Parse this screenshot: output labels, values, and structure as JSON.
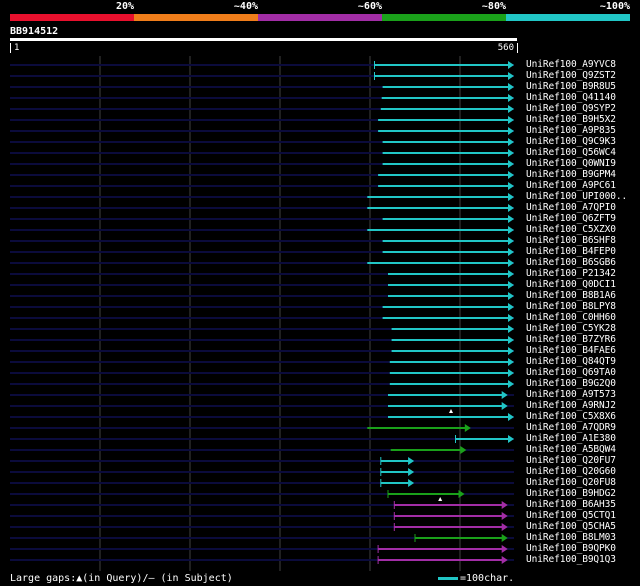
{
  "legend": {
    "labels": [
      "20%",
      "~40%",
      "~60%",
      "~80%",
      "~100%"
    ],
    "colors": [
      "#e8102d",
      "#ef7d1a",
      "#a22da6",
      "#1aa11a",
      "#21c6c6"
    ]
  },
  "query": {
    "id": "BB914512",
    "start": "1",
    "end": "560",
    "length": 560
  },
  "colors": {
    "line_color": "#0b0b3c",
    "grid_color": "#404040"
  },
  "hits": [
    {
      "label": "UniRef100_A9YVC8",
      "start": 405,
      "end": 560,
      "color": "cyan",
      "ticks": [
        405
      ]
    },
    {
      "label": "UniRef100_Q9ZST2",
      "start": 405,
      "end": 560,
      "color": "cyan",
      "ticks": [
        405
      ]
    },
    {
      "label": "UniRef100_B9R8U5",
      "start": 414,
      "end": 560,
      "color": "cyan",
      "ticks": []
    },
    {
      "label": "UniRef100_Q41140",
      "start": 413,
      "end": 560,
      "color": "cyan",
      "ticks": []
    },
    {
      "label": "UniRef100_Q9SYP2",
      "start": 412,
      "end": 560,
      "color": "cyan",
      "ticks": []
    },
    {
      "label": "UniRef100_B9H5X2",
      "start": 409,
      "end": 560,
      "color": "cyan",
      "ticks": []
    },
    {
      "label": "UniRef100_A9P835",
      "start": 409,
      "end": 560,
      "color": "cyan",
      "ticks": []
    },
    {
      "label": "UniRef100_Q9C9K3",
      "start": 414,
      "end": 560,
      "color": "cyan",
      "ticks": []
    },
    {
      "label": "UniRef100_Q56WC4",
      "start": 414,
      "end": 560,
      "color": "cyan",
      "ticks": []
    },
    {
      "label": "UniRef100_Q0WNI9",
      "start": 414,
      "end": 560,
      "color": "cyan",
      "ticks": []
    },
    {
      "label": "UniRef100_B9GPM4",
      "start": 409,
      "end": 560,
      "color": "cyan",
      "ticks": []
    },
    {
      "label": "UniRef100_A9PC61",
      "start": 409,
      "end": 560,
      "color": "cyan",
      "ticks": []
    },
    {
      "label": "UniRef100_UPI000..",
      "start": 397,
      "end": 560,
      "color": "cyan",
      "ticks": []
    },
    {
      "label": "UniRef100_A7QPI0",
      "start": 397,
      "end": 560,
      "color": "cyan",
      "ticks": []
    },
    {
      "label": "UniRef100_Q6ZFT9",
      "start": 414,
      "end": 560,
      "color": "cyan",
      "ticks": []
    },
    {
      "label": "UniRef100_C5XZX0",
      "start": 397,
      "end": 560,
      "color": "cyan",
      "ticks": []
    },
    {
      "label": "UniRef100_B6SHF8",
      "start": 414,
      "end": 560,
      "color": "cyan",
      "ticks": []
    },
    {
      "label": "UniRef100_B4FEP0",
      "start": 414,
      "end": 560,
      "color": "cyan",
      "ticks": []
    },
    {
      "label": "UniRef100_B6SGB6",
      "start": 397,
      "end": 560,
      "color": "cyan",
      "ticks": []
    },
    {
      "label": "UniRef100_P21342",
      "start": 420,
      "end": 560,
      "color": "cyan",
      "ticks": []
    },
    {
      "label": "UniRef100_Q0DCI1",
      "start": 420,
      "end": 560,
      "color": "cyan",
      "ticks": []
    },
    {
      "label": "UniRef100_B8B1A6",
      "start": 420,
      "end": 560,
      "color": "cyan",
      "ticks": []
    },
    {
      "label": "UniRef100_B8LPY8",
      "start": 414,
      "end": 560,
      "color": "cyan",
      "ticks": []
    },
    {
      "label": "UniRef100_C0HH60",
      "start": 414,
      "end": 560,
      "color": "cyan",
      "ticks": []
    },
    {
      "label": "UniRef100_C5YK28",
      "start": 424,
      "end": 560,
      "color": "cyan",
      "ticks": []
    },
    {
      "label": "UniRef100_B7ZYR6",
      "start": 424,
      "end": 560,
      "color": "cyan",
      "ticks": []
    },
    {
      "label": "UniRef100_B4FAE6",
      "start": 424,
      "end": 560,
      "color": "cyan",
      "ticks": []
    },
    {
      "label": "UniRef100_Q84QT9",
      "start": 422,
      "end": 560,
      "color": "cyan",
      "ticks": []
    },
    {
      "label": "UniRef100_Q69TA0",
      "start": 422,
      "end": 560,
      "color": "cyan",
      "ticks": []
    },
    {
      "label": "UniRef100_B9G2Q0",
      "start": 422,
      "end": 560,
      "color": "cyan",
      "ticks": []
    },
    {
      "label": "UniRef100_A9T573",
      "start": 420,
      "end": 553,
      "color": "cyan",
      "ticks": []
    },
    {
      "label": "UniRef100_A9RNJ2",
      "start": 420,
      "end": 553,
      "color": "cyan",
      "ticks": [],
      "gap_markers": [
        490
      ]
    },
    {
      "label": "UniRef100_C5X8X6",
      "start": 420,
      "end": 560,
      "color": "cyan",
      "ticks": []
    },
    {
      "label": "UniRef100_A7QDR9",
      "start": 397,
      "end": 512,
      "color": "green",
      "ticks": []
    },
    {
      "label": "UniRef100_A1E380",
      "start": 495,
      "end": 560,
      "color": "cyan",
      "ticks": [
        495
      ]
    },
    {
      "label": "UniRef100_A5BQW4",
      "start": 423,
      "end": 507,
      "color": "green",
      "ticks": []
    },
    {
      "label": "UniRef100_Q20FU7",
      "start": 412,
      "end": 449,
      "color": "cyan",
      "ticks": [
        412
      ]
    },
    {
      "label": "UniRef100_Q20G60",
      "start": 412,
      "end": 449,
      "color": "cyan",
      "ticks": [
        412
      ]
    },
    {
      "label": "UniRef100_Q20FU8",
      "start": 412,
      "end": 449,
      "color": "cyan",
      "ticks": [
        412
      ]
    },
    {
      "label": "UniRef100_B9HDG2",
      "start": 420,
      "end": 505,
      "color": "green",
      "ticks": [
        420
      ],
      "gap_markers": [
        478
      ]
    },
    {
      "label": "UniRef100_B6AH35",
      "start": 427,
      "end": 553,
      "color": "purple",
      "ticks": [
        427
      ]
    },
    {
      "label": "UniRef100_Q5CTQ1",
      "start": 427,
      "end": 553,
      "color": "purple",
      "ticks": [
        427
      ]
    },
    {
      "label": "UniRef100_Q5CHA5",
      "start": 427,
      "end": 553,
      "color": "purple",
      "ticks": [
        427
      ]
    },
    {
      "label": "UniRef100_B8LM03",
      "start": 450,
      "end": 553,
      "color": "green",
      "ticks": [
        450
      ]
    },
    {
      "label": "UniRef100_B9QPK0",
      "start": 409,
      "end": 553,
      "color": "purple",
      "ticks": [
        409
      ]
    },
    {
      "label": "UniRef100_B9Q1Q3",
      "start": 409,
      "end": 553,
      "color": "purple",
      "ticks": [
        409
      ]
    }
  ],
  "footer": {
    "left": "Large gaps:▲(in Query)/– (in Subject)",
    "right": "=100char."
  }
}
